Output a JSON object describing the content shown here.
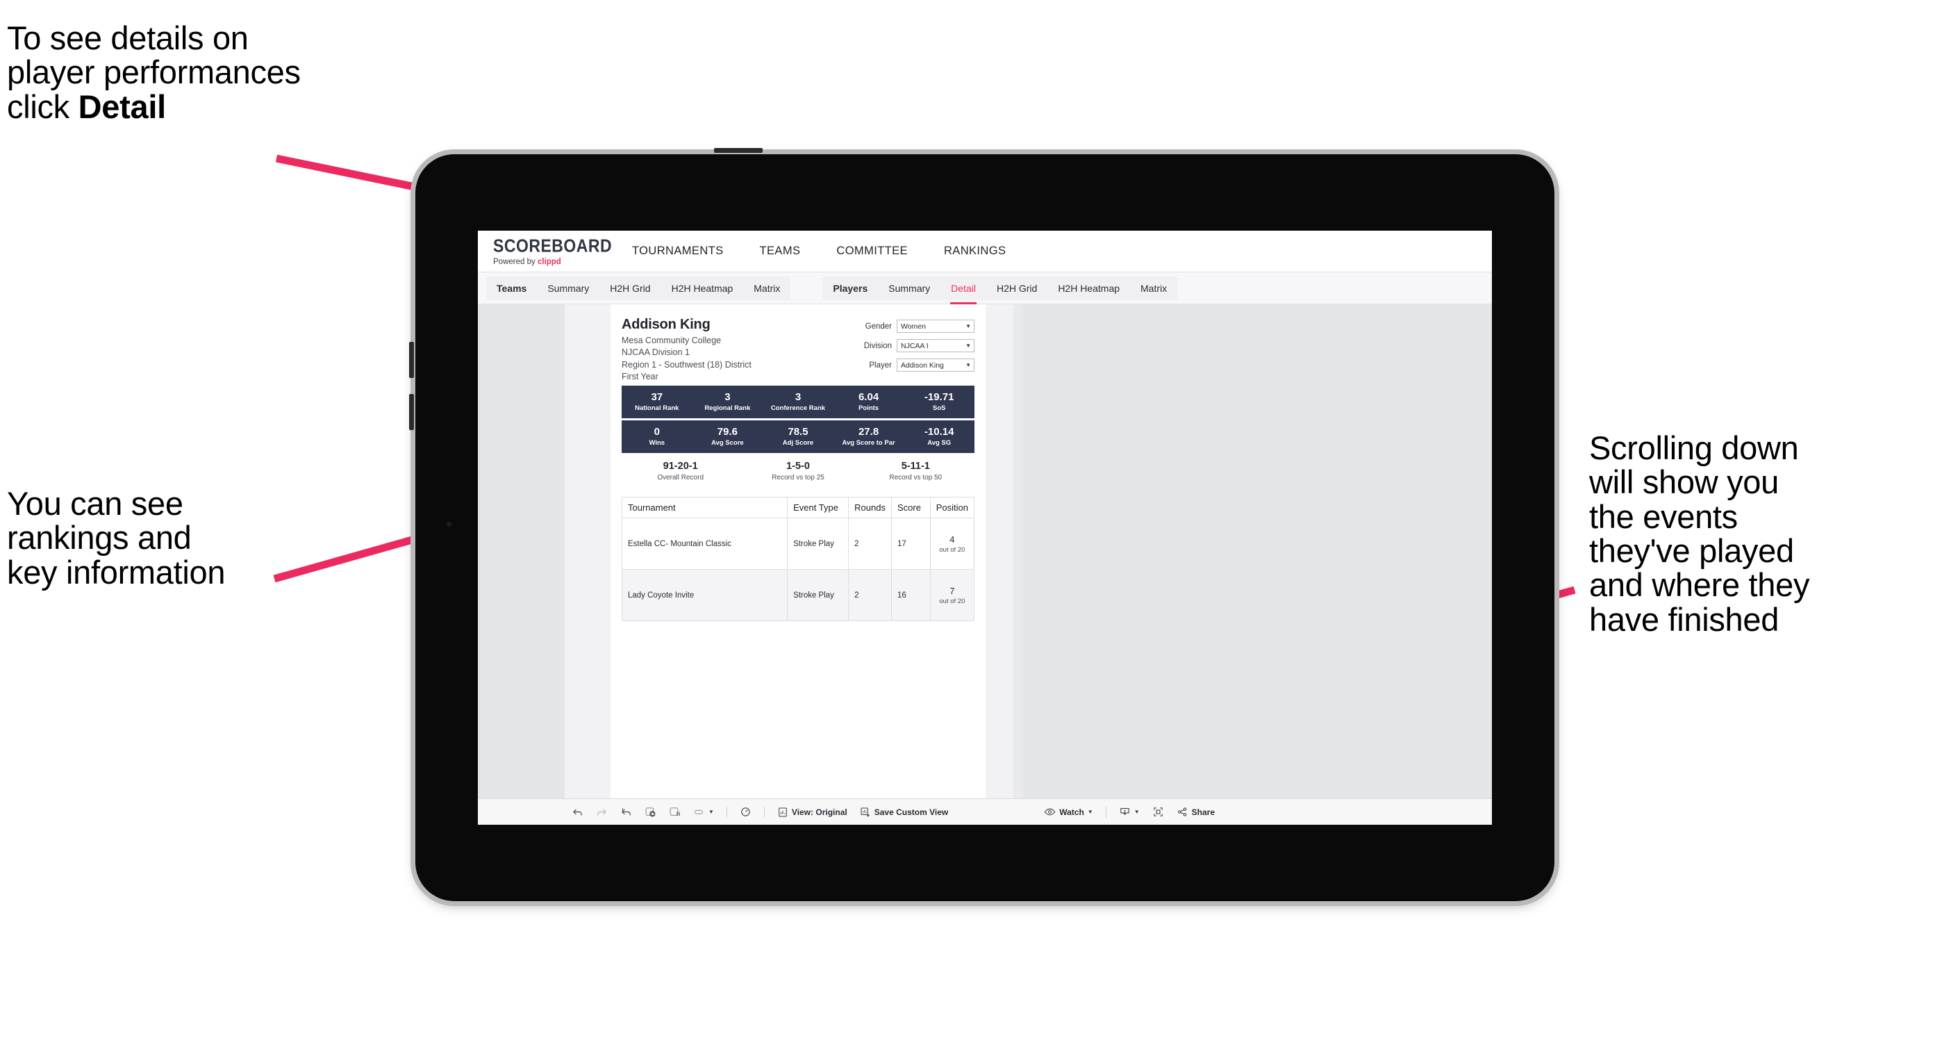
{
  "annotations": {
    "top_left": "To see details on\nplayer performances\nclick ",
    "top_left_bold": "Detail",
    "mid_left": "You can see\nrankings and\nkey information",
    "right": "Scrolling down\nwill show you\nthe events\nthey've played\nand where they\nhave finished",
    "arrow_color": "#ec2a5f"
  },
  "app": {
    "brand": {
      "title": "SCOREBOARD",
      "powered_prefix": "Powered by ",
      "powered_name": "clippd"
    },
    "main_nav": [
      "TOURNAMENTS",
      "TEAMS",
      "COMMITTEE",
      "RANKINGS"
    ],
    "subnav_group_1": [
      "Teams",
      "Summary",
      "H2H Grid",
      "H2H Heatmap",
      "Matrix"
    ],
    "subnav_group_2": [
      "Players",
      "Summary",
      "Detail",
      "H2H Grid",
      "H2H Heatmap",
      "Matrix"
    ],
    "subnav_active": "Detail",
    "accent_color": "#e8335c",
    "stat_bar_color": "#303751"
  },
  "player": {
    "name": "Addison King",
    "school": "Mesa Community College",
    "division": "NJCAA Division 1",
    "region": "Region 1 - Southwest (18) District",
    "year": "First Year"
  },
  "filters": [
    {
      "label": "Gender",
      "value": "Women"
    },
    {
      "label": "Division",
      "value": "NJCAA I"
    },
    {
      "label": "Player",
      "value": "Addison King"
    }
  ],
  "stats_row_1": [
    {
      "value": "37",
      "label": "National Rank"
    },
    {
      "value": "3",
      "label": "Regional Rank"
    },
    {
      "value": "3",
      "label": "Conference Rank"
    },
    {
      "value": "6.04",
      "label": "Points"
    },
    {
      "value": "-19.71",
      "label": "SoS"
    }
  ],
  "stats_row_2": [
    {
      "value": "0",
      "label": "Wins"
    },
    {
      "value": "79.6",
      "label": "Avg Score"
    },
    {
      "value": "78.5",
      "label": "Adj Score"
    },
    {
      "value": "27.8",
      "label": "Avg Score to Par"
    },
    {
      "value": "-10.14",
      "label": "Avg SG"
    }
  ],
  "records": [
    {
      "value": "91-20-1",
      "label": "Overall Record"
    },
    {
      "value": "1-5-0",
      "label": "Record vs top 25"
    },
    {
      "value": "5-11-1",
      "label": "Record vs top 50"
    }
  ],
  "events_table": {
    "headers": [
      "Tournament",
      "Event Type",
      "Rounds",
      "Score",
      "Position"
    ],
    "rows": [
      {
        "tournament": "Estella CC- Mountain Classic",
        "event_type": "Stroke Play",
        "rounds": "2",
        "score": "17",
        "position": "4",
        "position_of": "out of 20"
      },
      {
        "tournament": "Lady Coyote Invite",
        "event_type": "Stroke Play",
        "rounds": "2",
        "score": "16",
        "position": "7",
        "position_of": "out of 20"
      }
    ]
  },
  "toolbar": {
    "view_label": "View: Original",
    "save_label": "Save Custom View",
    "watch_label": "Watch",
    "share_label": "Share"
  }
}
